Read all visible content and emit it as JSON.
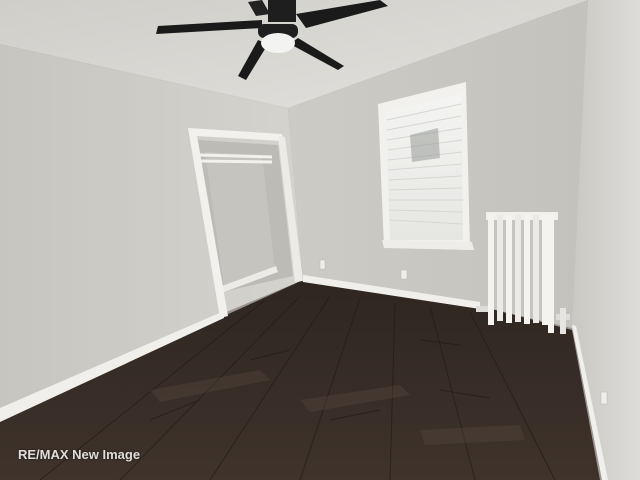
{
  "scene": {
    "description_colors": {
      "ceiling": "#d9d8d3",
      "left_wall": "#cfcdc7",
      "back_wall": "#c9c7c1",
      "right_wall": "#d2d1cc",
      "floor": "#3b3029",
      "trim": "#f2f1ee",
      "fan": "#1c1c1c"
    }
  },
  "watermark": {
    "text": "RE/MAX New Image"
  }
}
